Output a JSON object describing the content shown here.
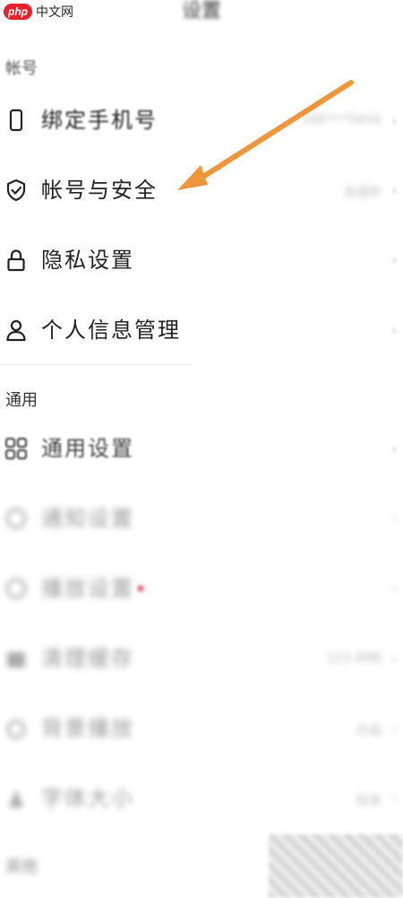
{
  "watermark": {
    "badge": "php",
    "text": "中文网"
  },
  "header": {
    "title": "设置"
  },
  "sections": [
    {
      "header": "帐号"
    },
    {
      "header": "通用"
    },
    {
      "header": "其他"
    }
  ],
  "account_items": [
    {
      "label": "绑定手机号",
      "value": "188****5656",
      "icon": "phone-icon"
    },
    {
      "label": "帐号与安全",
      "value": "去保护",
      "icon": "shield-check-icon"
    },
    {
      "label": "隐私设置",
      "value": "",
      "icon": "lock-icon"
    },
    {
      "label": "个人信息管理",
      "value": "",
      "icon": "person-icon"
    }
  ],
  "general_items": [
    {
      "label": "通用设置",
      "value": "",
      "icon": "grid-icon"
    },
    {
      "label": "通知设置",
      "value": "",
      "icon": "bell-icon"
    },
    {
      "label": "播放设置",
      "value": "",
      "icon": "play-circle-icon"
    },
    {
      "label": "清理缓存",
      "value": "123.4MB",
      "icon": "broom-icon"
    },
    {
      "label": "背景播放",
      "value": "开启",
      "icon": "headphones-icon"
    },
    {
      "label": "字体大小",
      "value": "标准",
      "icon": "text-size-icon"
    }
  ],
  "colors": {
    "arrow": "#f0953a",
    "brand_red": "#e8212b"
  }
}
